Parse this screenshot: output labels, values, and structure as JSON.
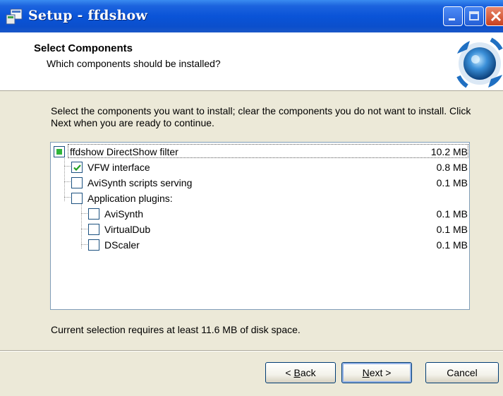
{
  "window": {
    "title": "Setup - ffdshow",
    "app_icon": "setup-icon",
    "controls": [
      "minimize-icon",
      "maximize-icon",
      "close-icon"
    ]
  },
  "header": {
    "title": "Select Components",
    "subtitle": "Which components should be installed?",
    "logo": "ffdshow-logo-icon"
  },
  "content": {
    "description": "Select the components you want to install; clear the components you do not want to install. Click Next when you are ready to continue.",
    "components": [
      {
        "label": "ffdshow DirectShow filter",
        "size": "10.2 MB",
        "state": "partial",
        "level": 0
      },
      {
        "label": "VFW interface",
        "size": "0.8 MB",
        "state": "checked",
        "level": 1
      },
      {
        "label": "AviSynth scripts serving",
        "size": "0.1 MB",
        "state": "unchecked",
        "level": 1
      },
      {
        "label": "Application plugins:",
        "size": "",
        "state": "unchecked",
        "level": 1
      },
      {
        "label": "AviSynth",
        "size": "0.1 MB",
        "state": "unchecked",
        "level": 2
      },
      {
        "label": "VirtualDub",
        "size": "0.1 MB",
        "state": "unchecked",
        "level": 2
      },
      {
        "label": "DScaler",
        "size": "0.1 MB",
        "state": "unchecked",
        "level": 2
      }
    ],
    "space_required": "Current selection requires at least 11.6 MB of disk space."
  },
  "buttons": {
    "back_prefix": "< ",
    "back_accel": "B",
    "back_rest": "ack",
    "next_accel": "N",
    "next_rest": "ext >",
    "cancel": "Cancel"
  },
  "colors": {
    "titlebar": "#0a54d8",
    "dialog_bg": "#ece9d8",
    "partial_fill": "#2fb53a",
    "check_mark": "#21a121"
  }
}
